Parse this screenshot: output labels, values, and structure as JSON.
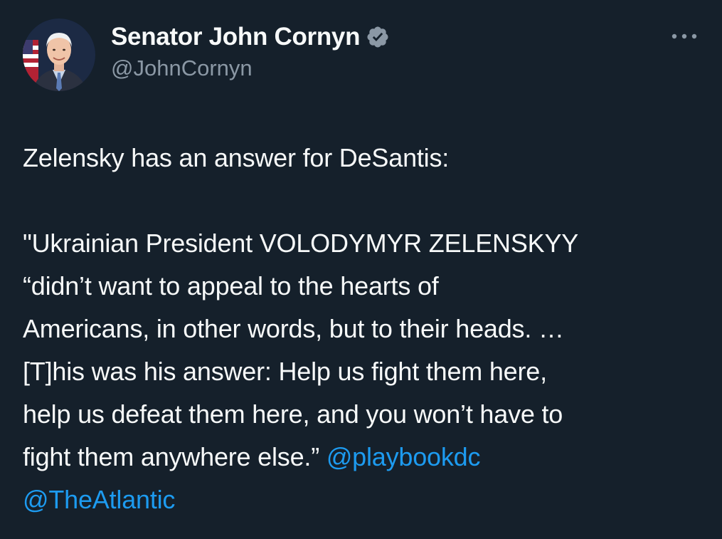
{
  "author": {
    "display_name": "Senator John Cornyn",
    "handle": "@JohnCornyn",
    "verified": true,
    "verified_badge_color": "#8b98a5"
  },
  "tweet": {
    "lines": [
      "Zelensky has an answer for DeSantis:",
      "\"Ukrainian President VOLODYMYR ZELENSKYY",
      "“didn’t want to appeal to the hearts of",
      "Americans, in other words, but to their heads. …",
      "[T]his was his answer: Help us fight them here,",
      "help us defeat them here, and you won’t have to",
      "fight them anywhere else.”"
    ],
    "mentions": [
      "@playbookdc",
      "@TheAtlantic"
    ]
  },
  "theme": {
    "background": "#15202b",
    "text": "#f7f9f9",
    "secondary_text": "#8b98a5",
    "link": "#1d9bf0"
  },
  "icons": {
    "verified": "verified-badge-icon",
    "more": "more-options-icon"
  }
}
